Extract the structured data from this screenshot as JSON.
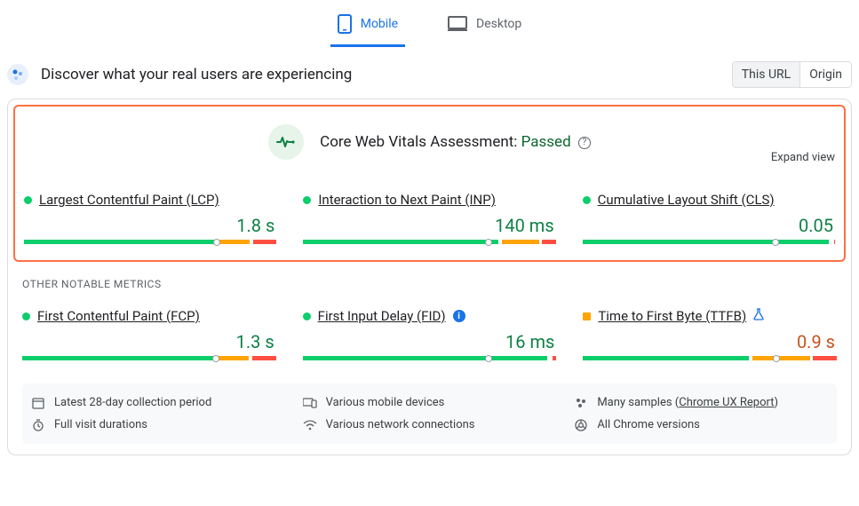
{
  "tabs": {
    "mobile": "Mobile",
    "desktop": "Desktop",
    "active": "mobile"
  },
  "header": {
    "title": "Discover what your real users are experiencing",
    "scope": {
      "this_url": "This URL",
      "origin": "Origin",
      "active": "this_url"
    }
  },
  "assessment": {
    "label": "Core Web Vitals Assessment:",
    "status": "Passed",
    "expand": "Expand view"
  },
  "colors": {
    "good": "#0cce6b",
    "needs": "#ffa400",
    "poor": "#ff4e42"
  },
  "core_metrics": [
    {
      "id": "lcp",
      "name": "Largest Contentful Paint (LCP)",
      "value": "1.8 s",
      "rating": "good",
      "dist": {
        "good": 76,
        "needs": 14,
        "poor": 10
      },
      "marker_pct": 76
    },
    {
      "id": "inp",
      "name": "Interaction to Next Paint (INP)",
      "value": "140 ms",
      "rating": "good",
      "dist": {
        "good": 78,
        "needs": 16,
        "poor": 6
      },
      "marker_pct": 73
    },
    {
      "id": "cls",
      "name": "Cumulative Layout Shift (CLS)",
      "value": "0.05",
      "rating": "good",
      "dist": {
        "good": 98,
        "needs": 1,
        "poor": 1
      },
      "marker_pct": 76
    }
  ],
  "other_label": "OTHER NOTABLE METRICS",
  "other_metrics": [
    {
      "id": "fcp",
      "name": "First Contentful Paint (FCP)",
      "value": "1.3 s",
      "rating": "good",
      "dist": {
        "good": 76,
        "needs": 14,
        "poor": 10
      },
      "marker_pct": 76,
      "extra": null
    },
    {
      "id": "fid",
      "name": "First Input Delay (FID)",
      "value": "16 ms",
      "rating": "good",
      "dist": {
        "good": 97,
        "needs": 1,
        "poor": 2
      },
      "marker_pct": 73,
      "extra": "info"
    },
    {
      "id": "ttfb",
      "name": "Time to First Byte (TTFB)",
      "value": "0.9 s",
      "rating": "needs",
      "dist": {
        "good": 66,
        "needs": 24,
        "poor": 10
      },
      "marker_pct": 76,
      "extra": "flask"
    }
  ],
  "footer": {
    "period": "Latest 28-day collection period",
    "devices": "Various mobile devices",
    "samples_prefix": "Many samples (",
    "samples_link": "Chrome UX Report",
    "samples_suffix": ")",
    "durations": "Full visit durations",
    "network": "Various network connections",
    "versions": "All Chrome versions"
  }
}
